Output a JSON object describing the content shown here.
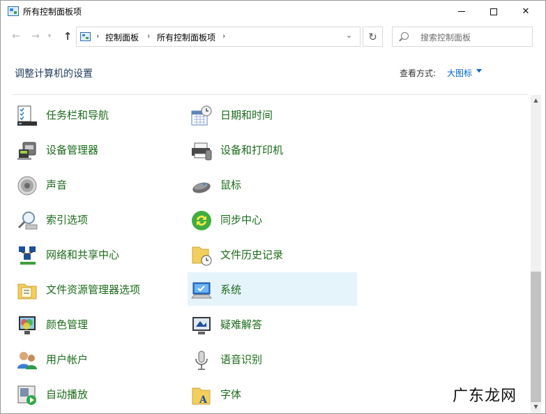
{
  "window": {
    "title": "所有控制面板项"
  },
  "nav": {
    "breadcrumbs": [
      "控制面板",
      "所有控制面板项"
    ],
    "search_placeholder": "搜索控制面板"
  },
  "header": {
    "title": "调整计算机的设置",
    "view_by_label": "查看方式:",
    "view_by_value": "大图标"
  },
  "items": [
    {
      "label": "任务栏和导航",
      "icon": "taskbar-icon"
    },
    {
      "label": "日期和时间",
      "icon": "calendar-clock-icon"
    },
    {
      "label": "设备管理器",
      "icon": "device-manager-icon"
    },
    {
      "label": "设备和打印机",
      "icon": "printer-icon"
    },
    {
      "label": "声音",
      "icon": "speaker-icon"
    },
    {
      "label": "鼠标",
      "icon": "mouse-icon"
    },
    {
      "label": "索引选项",
      "icon": "index-search-icon"
    },
    {
      "label": "同步中心",
      "icon": "sync-icon"
    },
    {
      "label": "网络和共享中心",
      "icon": "network-icon"
    },
    {
      "label": "文件历史记录",
      "icon": "file-history-icon"
    },
    {
      "label": "文件资源管理器选项",
      "icon": "folder-options-icon"
    },
    {
      "label": "系统",
      "icon": "system-icon"
    },
    {
      "label": "颜色管理",
      "icon": "color-management-icon"
    },
    {
      "label": "疑难解答",
      "icon": "troubleshooting-icon"
    },
    {
      "label": "用户帐户",
      "icon": "user-accounts-icon"
    },
    {
      "label": "语音识别",
      "icon": "microphone-icon"
    },
    {
      "label": "自动播放",
      "icon": "autoplay-icon"
    },
    {
      "label": "字体",
      "icon": "fonts-icon"
    }
  ],
  "selected_item": "系统",
  "watermark": "广东龙网",
  "colors": {
    "link_green": "#1b6b1b",
    "heading_blue": "#1e395b",
    "selection": "#e5f3fb",
    "accent_blue": "#0066cc"
  }
}
